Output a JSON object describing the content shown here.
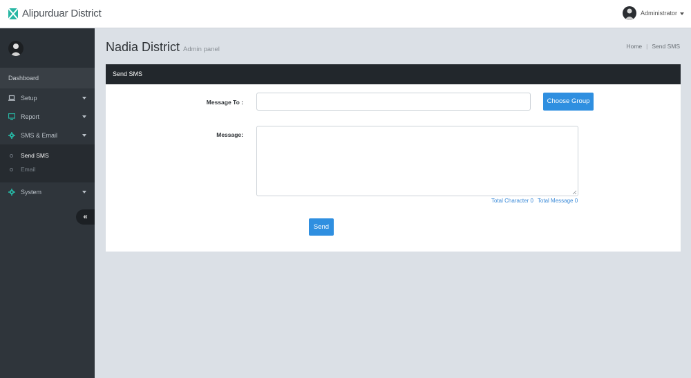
{
  "header": {
    "brand_title": "Alipurduar District",
    "user_name": "Administrator"
  },
  "sidebar": {
    "heading": "Dashboard",
    "items": [
      {
        "label": "Setup",
        "icon": "laptop-icon"
      },
      {
        "label": "Report",
        "icon": "monitor-icon"
      },
      {
        "label": "SMS & Email",
        "icon": "gear-icon"
      },
      {
        "label": "System",
        "icon": "gear-icon"
      }
    ],
    "submenu": [
      {
        "label": "Send SMS"
      },
      {
        "label": "Email"
      }
    ],
    "collapse_glyph": "«"
  },
  "page": {
    "title": "Nadia District",
    "subtitle": "Admin panel",
    "breadcrumb": [
      "Home",
      "Send SMS"
    ]
  },
  "panel": {
    "title": "Send SMS",
    "message_to_label": "Message To :",
    "message_to_value": "",
    "choose_group_label": "Choose Group",
    "message_label": "Message:",
    "message_value": "",
    "total_character": "Total Character 0",
    "total_message": "Total Message 0",
    "send_label": "Send"
  },
  "colors": {
    "accent": "#2f8fe0",
    "sidebar_bg": "#2f353b",
    "icon_teal": "#27b7a4"
  }
}
